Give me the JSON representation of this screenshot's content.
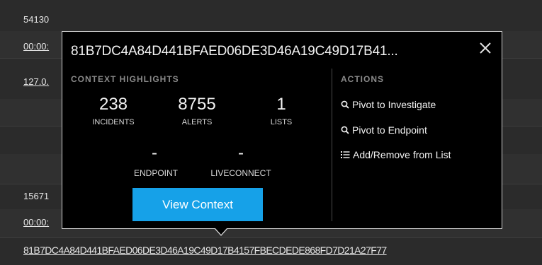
{
  "background": {
    "rows": [
      {
        "text": "54130"
      },
      {
        "text": "00:00:"
      },
      {
        "text": "127.0."
      },
      {
        "text": ""
      },
      {
        "text": ""
      },
      {
        "text": ""
      },
      {
        "text": "15671"
      },
      {
        "text": "00:00:"
      }
    ],
    "long_hash": "81B7DC4A84D441BFAED06DE3D46A19C49D17B4157FBECDEDE868FD7D21A27F77"
  },
  "popup": {
    "title": "81B7DC4A84D441BFAED06DE3D46A19C49D17B41...",
    "context_label": "CONTEXT HIGHLIGHTS",
    "actions_label": "ACTIONS",
    "stats": {
      "incidents": {
        "value": "238",
        "label": "INCIDENTS"
      },
      "alerts": {
        "value": "8755",
        "label": "ALERTS"
      },
      "lists": {
        "value": "1",
        "label": "LISTS"
      },
      "endpoint": {
        "value": "-",
        "label": "ENDPOINT"
      },
      "liveconnect": {
        "value": "-",
        "label": "LIVECONNECT"
      }
    },
    "actions": {
      "pivot_investigate": "Pivot to Investigate",
      "pivot_endpoint": "Pivot to Endpoint",
      "add_remove_list": "Add/Remove from List"
    },
    "view_context": "View Context"
  },
  "colors": {
    "accent": "#16a1e8",
    "popup_bg": "#000000",
    "page_bg": "#2b2b2b"
  }
}
